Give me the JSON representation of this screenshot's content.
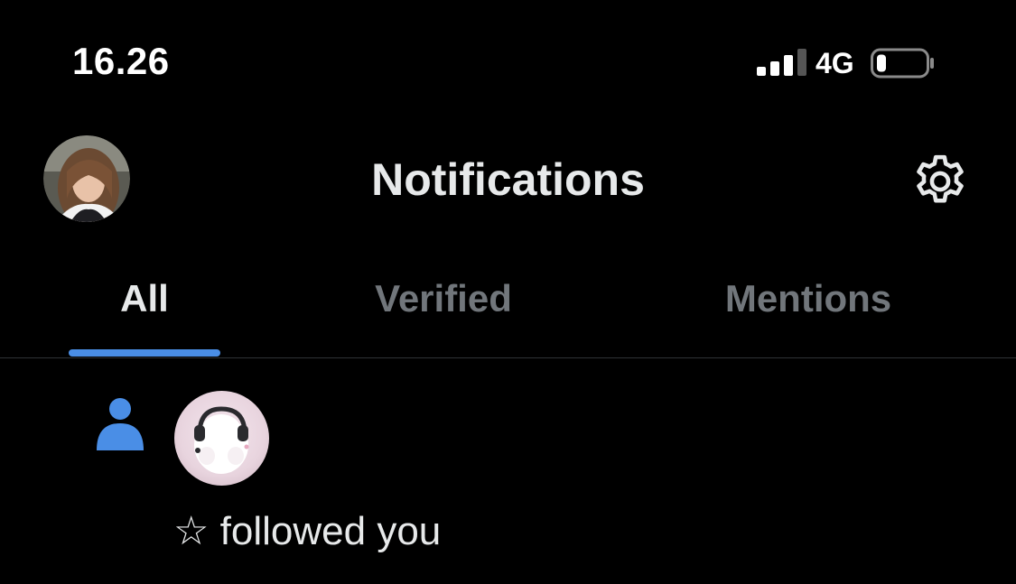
{
  "status_bar": {
    "time": "16.26",
    "network": "4G",
    "signal_bars_active": 3,
    "signal_bars_total": 4,
    "battery_level": 0.2
  },
  "header": {
    "title": "Notifications",
    "avatar_icon": "profile-avatar",
    "settings_icon": "gear-icon"
  },
  "tabs": [
    {
      "label": "All",
      "active": true
    },
    {
      "label": "Verified",
      "active": false
    },
    {
      "label": "Mentions",
      "active": false
    }
  ],
  "notifications": [
    {
      "type_icon": "person-icon",
      "text": "☆ followed you"
    }
  ],
  "colors": {
    "background": "#000000",
    "accent": "#4a8ee6",
    "text_primary": "#e7e9ea",
    "text_secondary": "#71767b",
    "divider": "#2f3336"
  }
}
